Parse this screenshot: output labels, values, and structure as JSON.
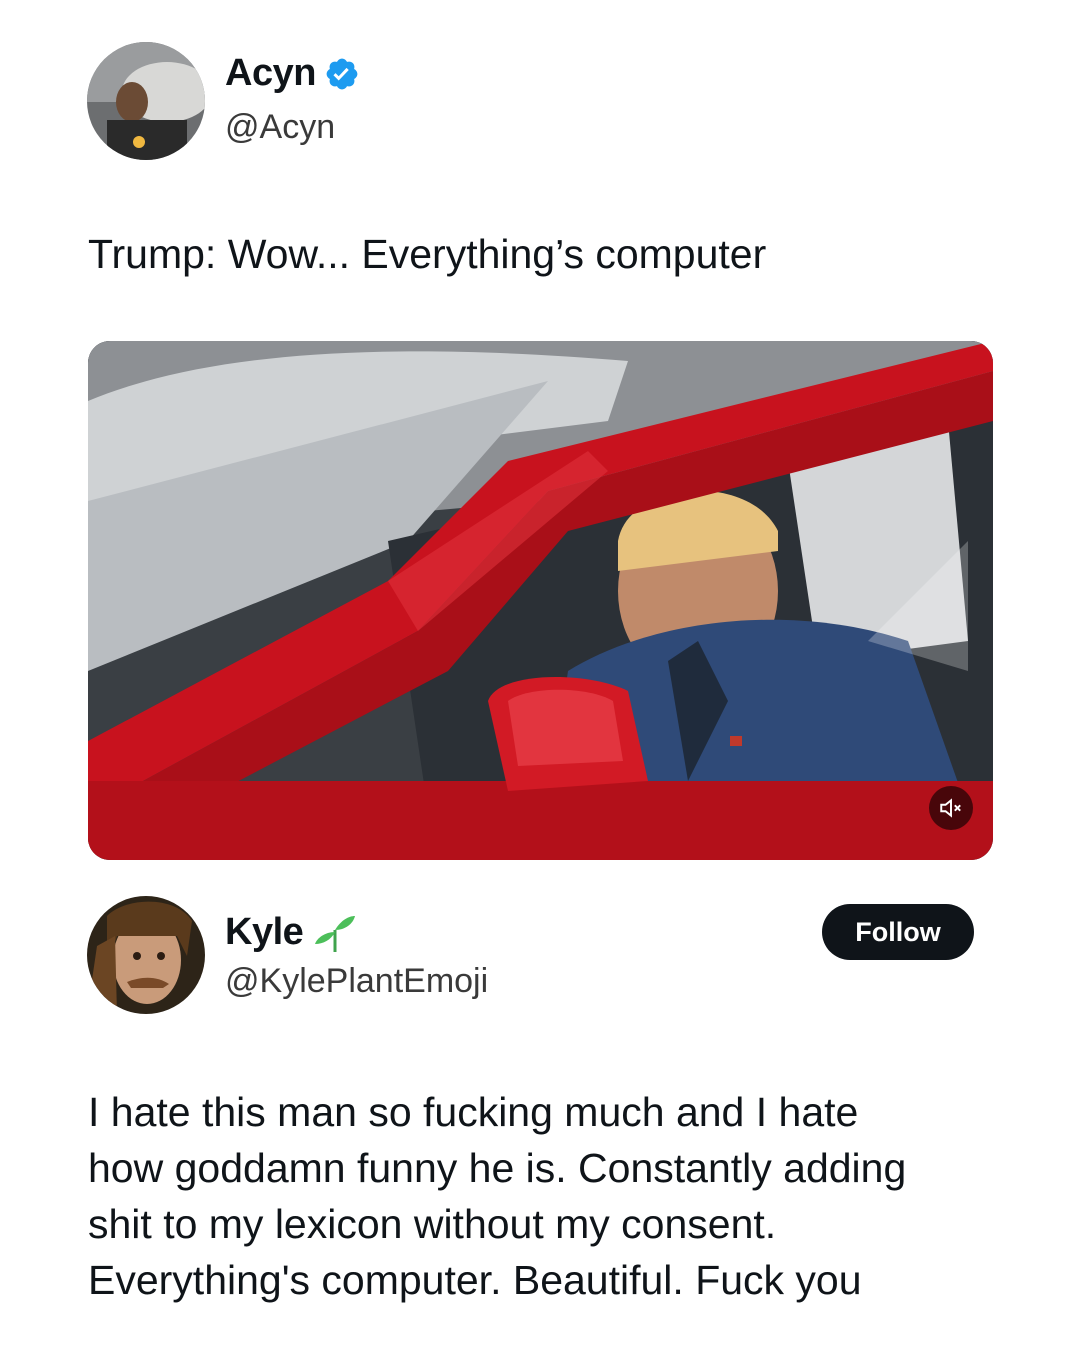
{
  "tweet": {
    "author": {
      "display_name": "Acyn",
      "handle": "@Acyn",
      "verified": true,
      "verified_icon": "verified-badge-icon",
      "verified_color": "#1d9bf0"
    },
    "text": "Trump: Wow... Everything’s computer",
    "media": {
      "type": "video",
      "muted": true,
      "mute_icon": "speaker-muted-icon"
    }
  },
  "reply": {
    "author": {
      "display_name": "Kyle",
      "handle": "@KylePlantEmoji",
      "name_emoji_icon": "seedling-icon"
    },
    "follow_label": "Follow",
    "text_lines": [
      "I hate this man so fucking much and I hate",
      "how goddamn funny he is. Constantly adding",
      "shit to my lexicon without my consent.",
      "Everything's computer. Beautiful. Fuck you"
    ]
  },
  "colors": {
    "text": "#0f1419",
    "follow_button_bg": "#0f1419",
    "follow_button_text": "#ffffff",
    "car_red": "#c8121e"
  }
}
